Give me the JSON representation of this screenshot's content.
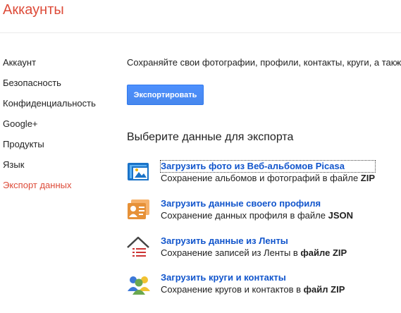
{
  "header": {
    "title": "Аккаунты"
  },
  "sidebar": {
    "items": [
      {
        "label": "Аккаунт",
        "active": false
      },
      {
        "label": "Безопасность",
        "active": false
      },
      {
        "label": "Конфиденциальность",
        "active": false
      },
      {
        "label": "Google+",
        "active": false
      },
      {
        "label": "Продукты",
        "active": false
      },
      {
        "label": "Язык",
        "active": false
      },
      {
        "label": "Экспорт данных",
        "active": true
      }
    ]
  },
  "main": {
    "intro": "Сохраняйте свои фотографии, профили, контакты, круги, а также",
    "export_button": "Экспортировать",
    "section_heading": "Выберите данные для экспорта",
    "exports": [
      {
        "icon": "picasa-photos-icon",
        "link": "Загрузить фото из Веб-альбомов Picasa",
        "desc_plain": "Сохранение альбомов и фотографий в файле ",
        "desc_bold": "ZIP"
      },
      {
        "icon": "profile-card-icon",
        "link": "Загрузить данные своего профиля",
        "desc_plain": "Сохранение данных профиля в файле ",
        "desc_bold": "JSON"
      },
      {
        "icon": "stream-house-icon",
        "link": "Загрузить данные из Ленты",
        "desc_plain": "Сохранение записей из Ленты в ",
        "desc_bold": "файле ZIP"
      },
      {
        "icon": "circles-contacts-icon",
        "link": "Загрузить круги и контакты",
        "desc_plain": "Сохранение кругов и контактов в ",
        "desc_bold": "файл ZIP"
      }
    ]
  },
  "colors": {
    "accent_red": "#dd4b39",
    "link_blue": "#1155cc",
    "button_blue": "#4d90fe"
  }
}
